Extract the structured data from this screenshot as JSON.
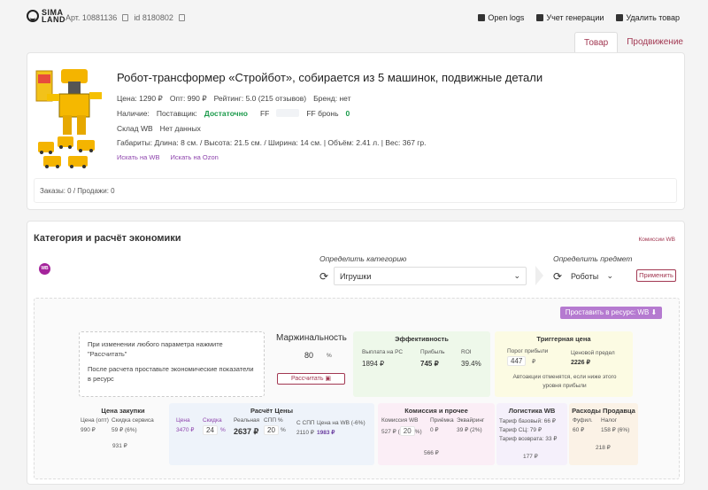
{
  "header": {
    "logo_top": "SIMA",
    "logo_bottom": "LAND",
    "article": "Арт. 10881136",
    "id": "id 8180802",
    "links": [
      "Open logs",
      "Учет генерации",
      "Удалить товар"
    ],
    "tabs": [
      "Товар",
      "Продвижение"
    ]
  },
  "product": {
    "title": "Робот-трансформер «Стройбот», собирается из 5 машинок, подвижные детали",
    "price": "Цена: 1290 ₽",
    "opt": "Опт: 990 ₽",
    "rating": "Рейтинг: 5.0 (215 отзывов)",
    "brand": "Бренд: нет",
    "availability_label": "Наличие:",
    "supplier_label": "Поставщик:",
    "supplier_value": "Достаточно",
    "ff_label": "FF",
    "ff_bron_label": "FF бронь",
    "ff_bron_value": "0",
    "warehouse_label": "Склад WB",
    "warehouse_value": "Нет данных",
    "dimensions": "Габариты: Длина: 8 см. / Высота: 21.5 см. / Ширина: 14 см. | Объём: 2.41 л. | Вес: 367 гр.",
    "search_wb": "Искать на WB",
    "search_ozon": "Искать на Ozon",
    "orders": "Заказы: 0 / Продажи: 0"
  },
  "economics": {
    "title": "Категория и расчёт экономики",
    "commission_link": "Комиссии WB",
    "badge": "WB",
    "category_label": "Определить категорию",
    "category_value": "Игрушки",
    "subject_label": "Определить предмет",
    "subject_value": "Роботы",
    "apply": "Применить",
    "send_button": "Проставить в ресурс: WB",
    "hint_1": "При изменении любого параметра нажмите \"Рассчитать\"",
    "hint_2": "После расчета проставьте экономические показатели в ресурс",
    "margin_title": "Маржинальность",
    "margin_value": "80",
    "margin_unit": "%",
    "calc_button": "Рассчитать",
    "efficiency": {
      "title": "Эффективность",
      "payout_label": "Выплата на РС",
      "payout_value": "1894 ₽",
      "profit_label": "Прибыль",
      "profit_value": "745 ₽",
      "roi_label": "ROI",
      "roi_value": "39.4%"
    },
    "trigger": {
      "title": "Триггерная цена",
      "threshold_label": "Порог прибыли",
      "threshold_value": "447",
      "threshold_unit": "₽",
      "limit_label": "Ценовой предел",
      "limit_value": "2226 ₽",
      "note": "Автоакции отменятся, если ниже этого уровня прибыли"
    },
    "purchase": {
      "title": "Цена закупки",
      "opt_label": "Цена (опт)",
      "opt_value": "990 ₽",
      "fee_label": "Скидка сервиса",
      "fee_value": "59 ₽ (6%)",
      "total": "931 ₽"
    },
    "price_calc": {
      "title": "Расчёт Цены",
      "price_label": "Цена",
      "price_value": "3470 ₽",
      "discount_label": "Скидка",
      "discount_value": "24",
      "discount_unit": "%",
      "real_label": "Реальная",
      "real_value": "2637 ₽",
      "spp_label": "СПП %",
      "spp_value": "20",
      "spp_unit": "%",
      "with_spp_label": "С СПП",
      "with_spp_value": "2110 ₽",
      "wb_price_label": "Цена на WB (-6%)",
      "wb_price_value": "1983 ₽"
    },
    "commission": {
      "title": "Комиссия и прочее",
      "wb_label": "Комиссия WB",
      "wb_value_prefix": "527 ₽ (",
      "wb_value": "20",
      "wb_value_suffix": "%)",
      "accept_label": "Приёмка",
      "accept_value": "0 ₽",
      "acq_label": "Эквайринг",
      "acq_value": "39 ₽ (2%)",
      "total": "566 ₽"
    },
    "logistics": {
      "title": "Логистика WB",
      "base": "Тариф базовый: 66 ₽",
      "sc": "Тариф СЦ: 79 ₽",
      "ret": "Тариф возврата: 33 ₽",
      "total": "177 ₽"
    },
    "seller": {
      "title": "Расходы Продавца",
      "ful_label": "Фуфил.",
      "ful_value": "60 ₽",
      "tax_label": "Налог",
      "tax_value": "158 ₽ (6%)",
      "total": "218 ₽"
    }
  }
}
